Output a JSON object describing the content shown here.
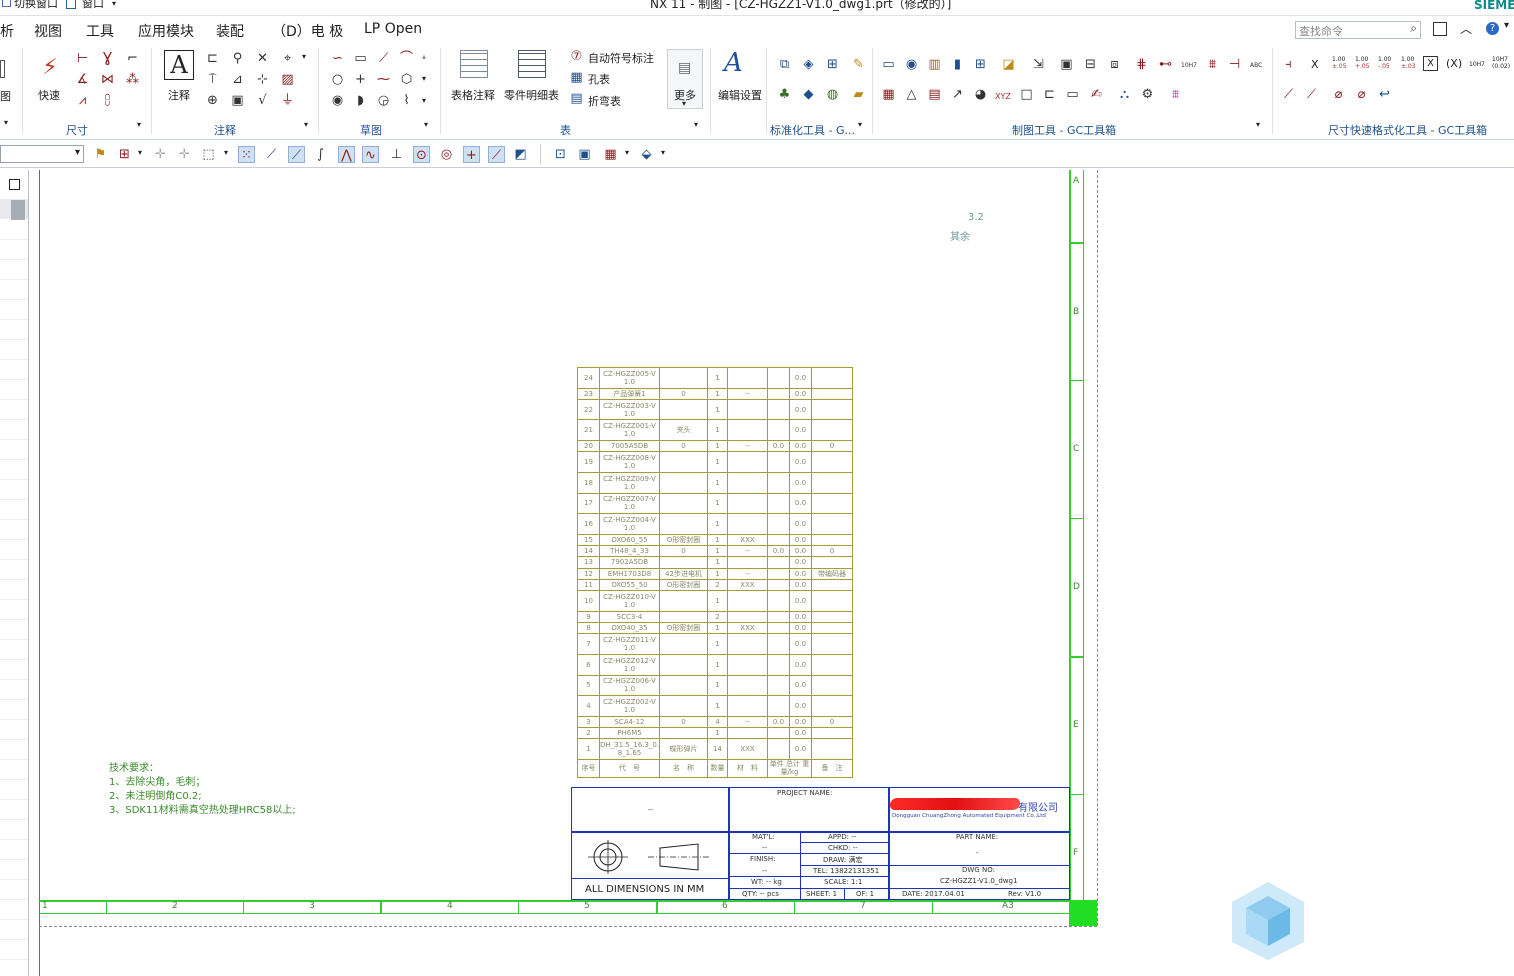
{
  "titlebar": {
    "switch_window": "切换窗口",
    "window_menu": "窗口",
    "title": "NX 11 - 制图 - [CZ-HGZZ1-V1.0_dwg1.prt（修改的）]",
    "brand": "SIEME"
  },
  "menu": {
    "partial": "析",
    "items": [
      "视图",
      "工具",
      "应用模块",
      "装配",
      "（D）电 极",
      "LP Open"
    ],
    "search_placeholder": "查找命令"
  },
  "ribbon": {
    "partial_label": "图",
    "dimension": {
      "quick": "快速",
      "group": "尺寸"
    },
    "annotation": {
      "note": "注释",
      "group": "注释"
    },
    "sketch": {
      "group": "草图"
    },
    "table": {
      "table_note": "表格注释",
      "parts_list": "零件明细表",
      "auto_balloon": "自动符号标注",
      "hole_table": "孔表",
      "bend_table": "折弯表",
      "more": "更多",
      "group": "表"
    },
    "edit_settings": "编辑设置",
    "std_tools": "标准化工具 - G...",
    "drafting_tools": "制图工具 - GC工具箱",
    "dim_format_tools": "尺寸快速格式化工具 - GC工具箱",
    "text_glyphs": {
      "x": "X",
      "v1": "1.00",
      "v1s": "±.05",
      "v2": "1.00",
      "v2s": "+.05",
      "v3": "1.00",
      "v3s": "-.05",
      "v4": "1.00",
      "v4s": "±.03",
      "boxx": "X",
      "px": "(X)",
      "h1": "10H7",
      "h2": "10H7",
      "h2s": "(0.02)",
      "abc": "ABC",
      "xyz": "XYZ"
    }
  },
  "drawing": {
    "roughness_value": "3.2",
    "roughness_rest": "其余",
    "zone_letters": [
      "A",
      "B",
      "C",
      "D",
      "E",
      "F"
    ],
    "zone_numbers": [
      "1",
      "2",
      "3",
      "4",
      "5",
      "6",
      "7",
      "A3"
    ],
    "tech_req": [
      "技术要求：",
      "1、去除尖角，毛刺；",
      "2、未注明倒角C0.2;",
      "3、SDK11材料需真空热处理HRC58以上;"
    ],
    "bom_header": [
      "序号",
      "代　号",
      "名　称",
      "数量",
      "材　料",
      "单件 总计 重 量/kg",
      "备　注"
    ],
    "bom_rows": [
      [
        "24",
        "CZ-HGZZ005-V1.0",
        "",
        "1",
        "",
        "",
        "0.0",
        ""
      ],
      [
        "23",
        "产品弹簧1",
        "0",
        "1",
        "--",
        "",
        "0.0",
        ""
      ],
      [
        "22",
        "CZ-HGZZ003-V1.0",
        "",
        "1",
        "",
        "",
        "0.0",
        ""
      ],
      [
        "21",
        "CZ-HGZZ001-V1.0",
        "夹头",
        "1",
        "",
        "",
        "0.0",
        ""
      ],
      [
        "20",
        "7005A5DB",
        "0",
        "1",
        "--",
        "0.0",
        "0.0",
        "0"
      ],
      [
        "19",
        "CZ-HGZZ008-V1.0",
        "",
        "1",
        "",
        "",
        "0.0",
        ""
      ],
      [
        "18",
        "CZ-HGZZ009-V1.0",
        "",
        "1",
        "",
        "",
        "0.0",
        ""
      ],
      [
        "17",
        "CZ-HGZZ007-V1.0",
        "",
        "1",
        "",
        "",
        "0.0",
        ""
      ],
      [
        "16",
        "CZ-HGZZ004-V1.0",
        "",
        "1",
        "",
        "",
        "0.0",
        ""
      ],
      [
        "15",
        "OXO60_55",
        "O形密封圈",
        "1",
        "XXX",
        "",
        "0.0",
        ""
      ],
      [
        "14",
        "TH48_4_33",
        "0",
        "1",
        "--",
        "0.0",
        "0.0",
        "0"
      ],
      [
        "13",
        "7902A5DB",
        "",
        "1",
        "",
        "",
        "0.0",
        ""
      ],
      [
        "12",
        "EMH1703D8",
        "42步进电机",
        "1",
        "--",
        "",
        "0.0",
        "带编码器"
      ],
      [
        "11",
        "OXO55_50",
        "O形密封圈",
        "2",
        "XXX",
        "",
        "0.0",
        ""
      ],
      [
        "10",
        "CZ-HGZZ010-V1.0",
        "",
        "1",
        "",
        "",
        "0.0",
        ""
      ],
      [
        "9",
        "SCC3-4",
        "",
        "2",
        "",
        "",
        "0.0",
        ""
      ],
      [
        "8",
        "OXO40_35",
        "O形密封圈",
        "1",
        "XXX",
        "",
        "0.0",
        ""
      ],
      [
        "7",
        "CZ-HGZZ011-V1.0",
        "",
        "1",
        "",
        "",
        "0.0",
        ""
      ],
      [
        "6",
        "CZ-HGZZ012-V1.0",
        "",
        "1",
        "",
        "",
        "0.0",
        ""
      ],
      [
        "5",
        "CZ-HGZZ006-V1.0",
        "",
        "1",
        "",
        "",
        "0.0",
        ""
      ],
      [
        "4",
        "CZ-HGZZ002-V1.0",
        "",
        "1",
        "",
        "",
        "0.0",
        ""
      ],
      [
        "3",
        "SCA4-12",
        "0",
        "4",
        "--",
        "0.0",
        "0.0",
        "0"
      ],
      [
        "2",
        "PH6M5",
        "",
        "1",
        "",
        "",
        "0.0",
        ""
      ],
      [
        "1",
        "DH_31.5_16.3_0.8_1.65",
        "蝶形弹片",
        "14",
        "XXX",
        "",
        "0.0",
        ""
      ]
    ],
    "title_block": {
      "dash": "--",
      "project_name": "PROJECT NAME:",
      "company": "有限公司",
      "company_en": "Dongguan ChuangZhong Automated Equipment Co.,Ltd",
      "matl_label": "MAT'L:",
      "matl": "--",
      "finish_label": "FINISH:",
      "finish": "--",
      "appd": "APPD: --",
      "chkd": "CHKD: --",
      "draw": "DRAW: 满宏",
      "tel": "TEL: 13822131351",
      "part_name_label": "PART NAME:",
      "part_name": "-",
      "dwg_no_label": "DWG NO:",
      "dwg_no": "CZ-HGZZ1-V1.0_dwg1",
      "wt": "WT: -- kg",
      "qty": "QTY: -- pcs",
      "scale": "SCALE: 1:1",
      "sheet": "SHEET: 1",
      "of": "OF: 1",
      "date": "DATE: 2017.04.01",
      "rev": "Rev: V1.0",
      "all_dims": "ALL DIMENSIONS IN MM"
    }
  }
}
